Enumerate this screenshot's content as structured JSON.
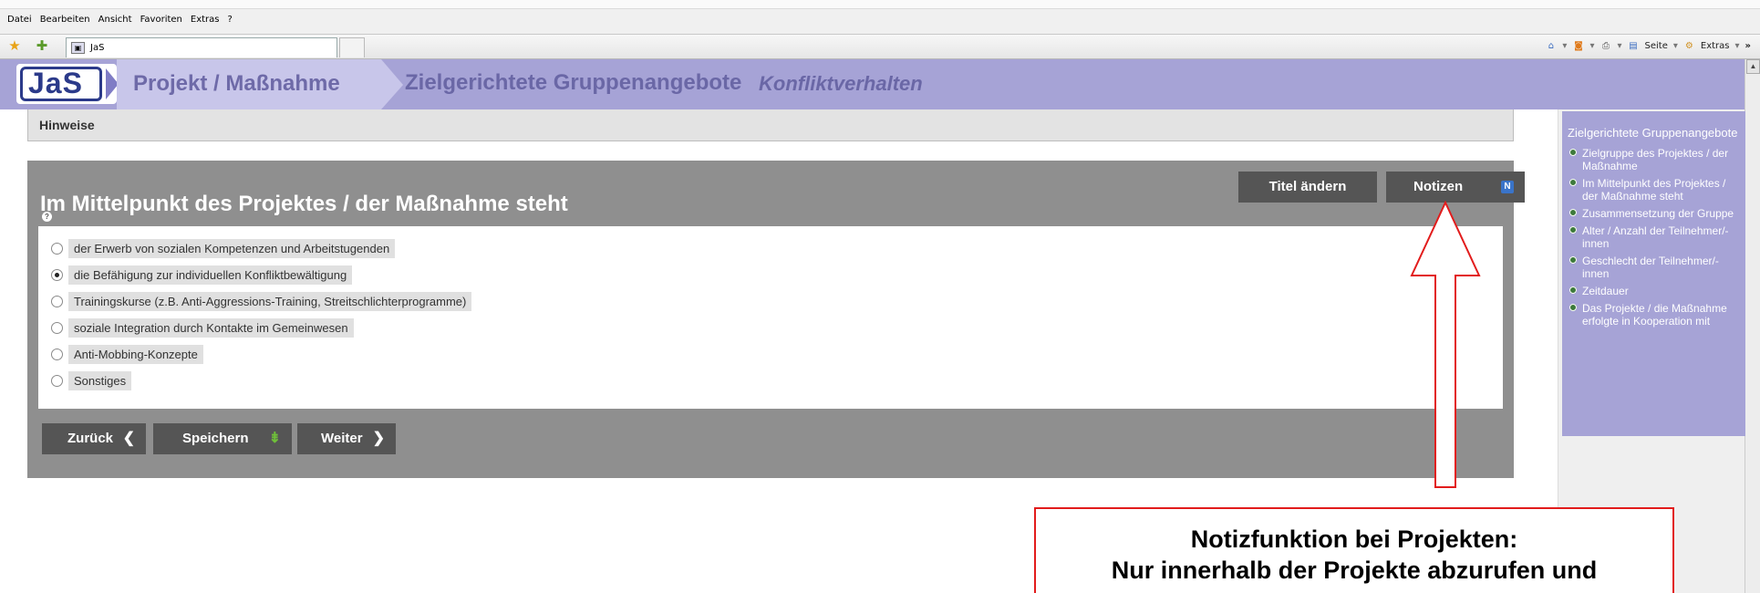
{
  "browser": {
    "menu": [
      "Datei",
      "Bearbeiten",
      "Ansicht",
      "Favoriten",
      "Extras",
      "?"
    ],
    "tab_title": "JaS",
    "tools": {
      "page_label": "Seite",
      "extras_label": "Extras",
      "overflow": "»"
    }
  },
  "header": {
    "logo_text": "JaS",
    "crumb1": "Projekt / Maßnahme",
    "crumb2": "Zielgerichtete Gruppenangebote",
    "crumb3": "Konfliktverhalten",
    "colors": {
      "band": "#a6a3d6",
      "crumb_text": "#6a67a6"
    }
  },
  "hinweise": "Hinweise",
  "main": {
    "title": "Im Mittelpunkt des Projektes / der Maßnahme steht",
    "buttons": {
      "titel": "Titel ändern",
      "notizen": "Notizen"
    },
    "options": [
      {
        "label": "der Erwerb von sozialen Kompetenzen und Arbeitstugenden",
        "selected": false
      },
      {
        "label": "die Befähigung zur individuellen Konfliktbewältigung",
        "selected": true
      },
      {
        "label": "Trainingskurse (z.B. Anti-Aggressions-Training, Streitschlichterprogramme)",
        "selected": false
      },
      {
        "label": "soziale Integration durch Kontakte im Gemeinwesen",
        "selected": false
      },
      {
        "label": "Anti-Mobbing-Konzepte",
        "selected": false
      },
      {
        "label": "Sonstiges",
        "selected": false
      }
    ],
    "nav": {
      "back": "Zurück",
      "save": "Speichern",
      "next": "Weiter"
    }
  },
  "sidebar": {
    "title": "Zielgerichtete Gruppenangebote",
    "items": [
      "Zielgruppe des Projektes / der Maßnahme",
      "Im Mittelpunkt des Projektes / der Maßnahme steht",
      "Zusammensetzung der Gruppe",
      "Alter / Anzahl der Teilnehmer/-innen",
      "Geschlecht der Teilnehmer/-innen",
      "Zeitdauer",
      "Das Projekte / die Maßnahme erfolgte in Kooperation mit"
    ]
  },
  "callout": {
    "line1": "Notizfunktion bei Projekten:",
    "line2": "Nur innerhalb der Projekte abzurufen und",
    "color": "#e21c1c"
  }
}
